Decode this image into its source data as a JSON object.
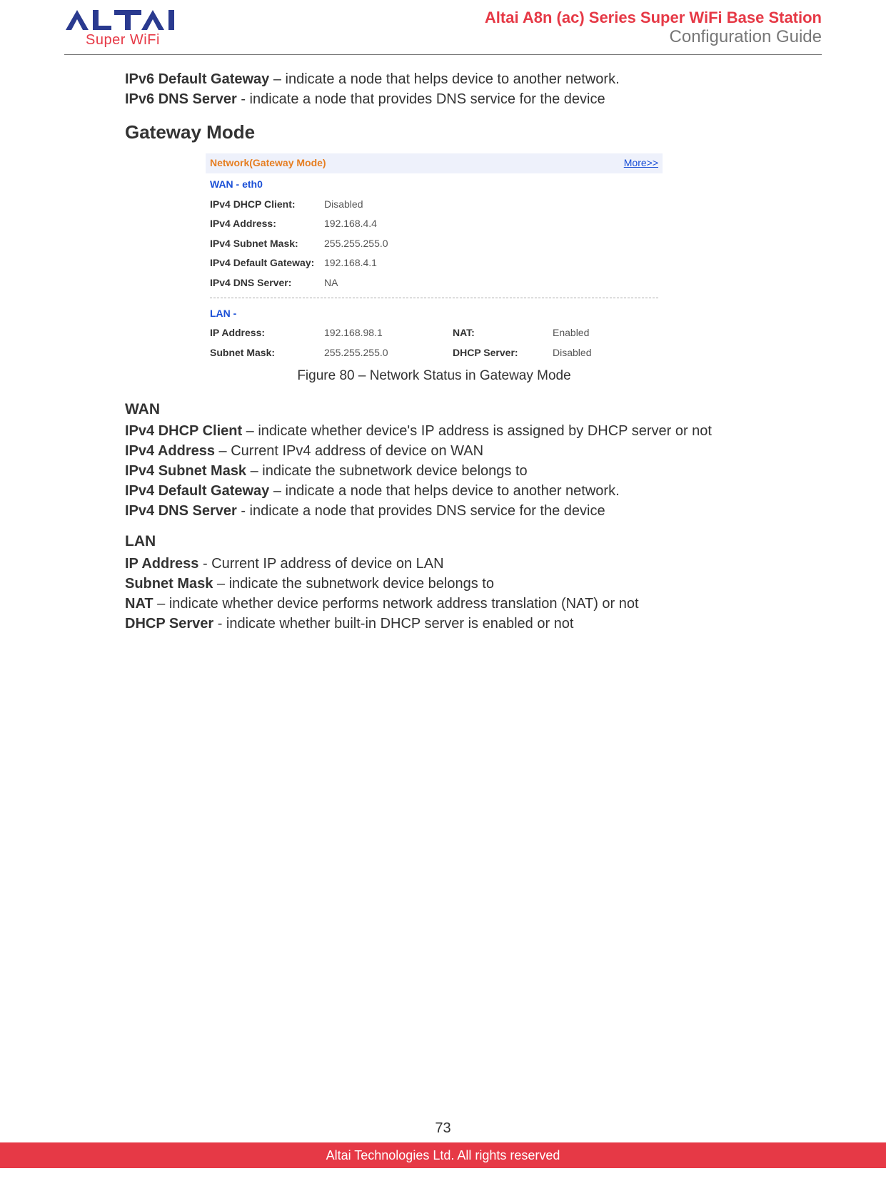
{
  "header": {
    "logo_text": "ALTAI",
    "logo_sub": "Super WiFi",
    "title1": "Altai A8n (ac) Series Super WiFi Base Station",
    "title2": "Configuration Guide"
  },
  "intro": {
    "ipv6_gateway_term": "IPv6 Default Gateway",
    "ipv6_gateway_desc": " – indicate a node that helps device to another network.",
    "ipv6_dns_term": "IPv6 DNS Server",
    "ipv6_dns_desc": " - indicate a node that provides DNS service for the device"
  },
  "section_heading": "Gateway Mode",
  "panel": {
    "heading": "Network(Gateway Mode)",
    "more": "More>>",
    "wan_sub": "WAN  -  eth0",
    "wan_rows": [
      {
        "label": "IPv4 DHCP Client:",
        "value": "Disabled"
      },
      {
        "label": "IPv4 Address:",
        "value": "192.168.4.4"
      },
      {
        "label": "IPv4 Subnet Mask:",
        "value": "255.255.255.0"
      },
      {
        "label": "IPv4 Default Gateway:",
        "value": "192.168.4.1"
      },
      {
        "label": "IPv4 DNS Server:",
        "value": "NA"
      }
    ],
    "lan_sub": "LAN  -",
    "lan": {
      "ip_label": "IP Address:",
      "ip_value": "192.168.98.1",
      "nat_label": "NAT:",
      "nat_value": "Enabled",
      "mask_label": "Subnet Mask:",
      "mask_value": "255.255.255.0",
      "dhcp_label": "DHCP Server:",
      "dhcp_value": "Disabled"
    }
  },
  "figure_caption": "Figure 80 – Network Status in Gateway Mode",
  "wan_section": {
    "heading": "WAN",
    "items": [
      {
        "term": "IPv4 DHCP Client",
        "desc": " – indicate whether device's IP address is assigned by DHCP server or not"
      },
      {
        "term": "IPv4 Address",
        "desc": " – Current IPv4 address of device on WAN"
      },
      {
        "term": "IPv4 Subnet Mask",
        "desc": " – indicate the subnetwork device belongs to"
      },
      {
        "term": "IPv4 Default Gateway",
        "desc": " – indicate a node that helps device to another network."
      },
      {
        "term": "IPv4 DNS Server",
        "desc": " - indicate a node that provides DNS service for the device"
      }
    ]
  },
  "lan_section": {
    "heading": "LAN",
    "items": [
      {
        "term": "IP Address",
        "desc": " - Current IP address of device on LAN"
      },
      {
        "term": "Subnet Mask",
        "desc": " – indicate the subnetwork device belongs to"
      },
      {
        "term": "NAT",
        "desc": " – indicate whether device performs network address translation (NAT) or not"
      },
      {
        "term": "DHCP Server",
        "desc": " - indicate whether built-in DHCP server is enabled or not"
      }
    ]
  },
  "page_number": "73",
  "footer": "Altai Technologies Ltd. All rights reserved"
}
